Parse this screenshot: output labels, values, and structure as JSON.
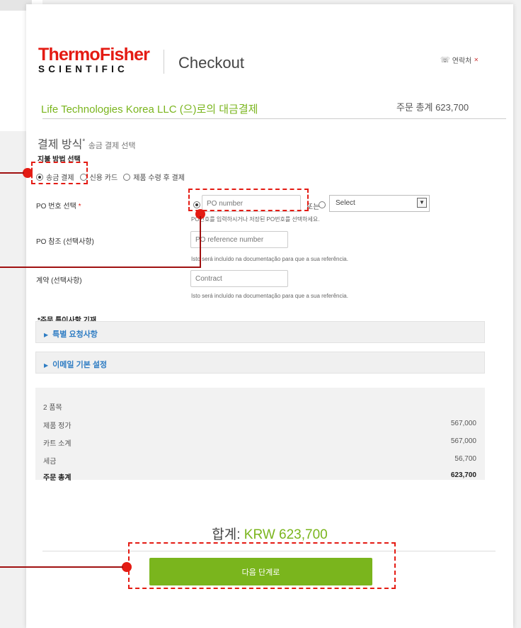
{
  "header": {
    "logo_top": "ThermoFisher",
    "logo_bottom": "SCIENTIFIC",
    "title": "Checkout",
    "contact_label": "연락처"
  },
  "order": {
    "company": "Life Technologies Korea LLC (으)로의 대금결제",
    "total_label": "주문 총계 623,700"
  },
  "payment": {
    "section_title": "결제 방식",
    "required_mark": "*",
    "section_subtitle": "송금 결제 선택",
    "sub_label": "지불 방법 선택",
    "options": [
      {
        "label": "송금 결제",
        "selected": true
      },
      {
        "label": "신용 카드",
        "selected": false
      },
      {
        "label": "제품 수령 후 결제",
        "selected": false
      }
    ]
  },
  "po": {
    "label": "PO 번호 선택",
    "required": "*",
    "placeholder": "PO number",
    "or_text": "또는",
    "select_value": "Select",
    "hint": "PO번호를 입력하시거나 저장된 PO번호를 선택하세요."
  },
  "po_reference": {
    "label": "PO 참조 (선택사항)",
    "placeholder": "PO reference number",
    "hint": "Isto será incluído na documentação para que a sua referência."
  },
  "contract": {
    "label": "계약 (선택사항)",
    "placeholder": "Contract",
    "hint": "Isto será incluído na documentação para que a sua referência."
  },
  "special": {
    "title": "*주문 특이사항 기재",
    "accordions": [
      "특별 요청사항",
      "이메일 기본 설정"
    ]
  },
  "summary": {
    "items_count": "2 품목",
    "rows": [
      {
        "label": "제품 정가",
        "value": "567,000"
      },
      {
        "label": "카트 소계",
        "value": "567,000"
      },
      {
        "label": "세금",
        "value": "56,700"
      },
      {
        "label": "주문 총계",
        "value": "623,700"
      }
    ]
  },
  "grand_total": {
    "label": "합계:",
    "amount": "KRW 623,700"
  },
  "next_button": "다음 단계로",
  "colors": {
    "brand_red": "#e41b13",
    "accent_green": "#7ab51d",
    "link_blue": "#2e7cc3",
    "annotation_red": "#e41b13"
  }
}
